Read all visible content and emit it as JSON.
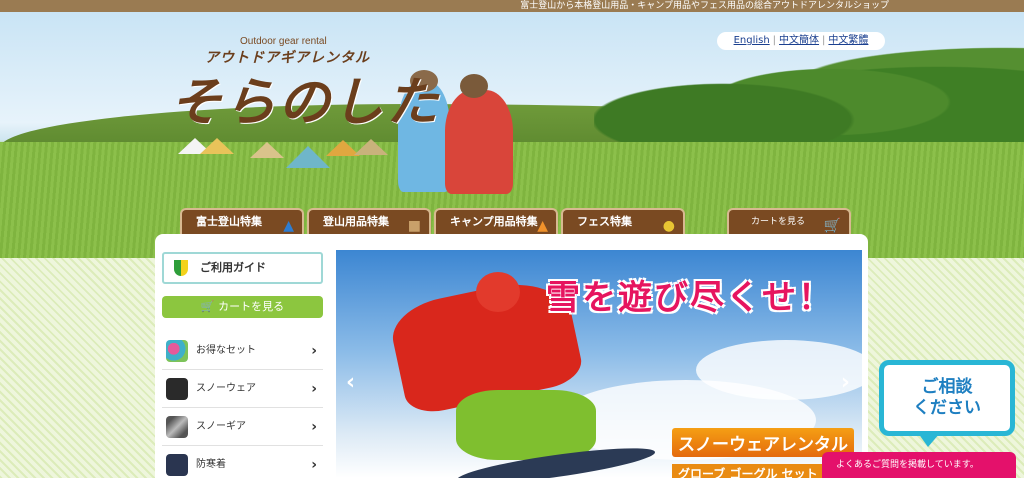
{
  "topbar": {
    "text": "富士登山から本格登山用品・キャンプ用品やフェス用品の総合アウトドアレンタルショップ"
  },
  "logo": {
    "small": "Outdoor gear rental",
    "kana": "アウトドアギアレンタル",
    "main": "そらのした"
  },
  "languages": [
    "English",
    "中文簡体",
    "中文繁體"
  ],
  "nav_tabs": [
    "富士登山特集",
    "登山用品特集",
    "キャンプ用品特集",
    "フェス特集"
  ],
  "cart_tab": "カートを見る",
  "sidebar": {
    "guide": "ご利用ガイド",
    "cart_button": "カートを見る",
    "items": [
      "お得なセット",
      "スノーウェア",
      "スノーギア",
      "防寒着"
    ]
  },
  "slider": {
    "headline": "雪を遊び尽くせ！",
    "sub1": "スノーウェアレンタル",
    "sub2": "グローブ ゴーグル セット"
  },
  "consult_bubble": {
    "line1": "ご相談",
    "line2": "ください"
  },
  "faq_bar": "よくあるご質問を掲載しています。",
  "colors": {
    "brown": "#7a4a22",
    "green": "#8cc63f",
    "pink": "#e4116b",
    "cyan": "#29b6d5"
  }
}
